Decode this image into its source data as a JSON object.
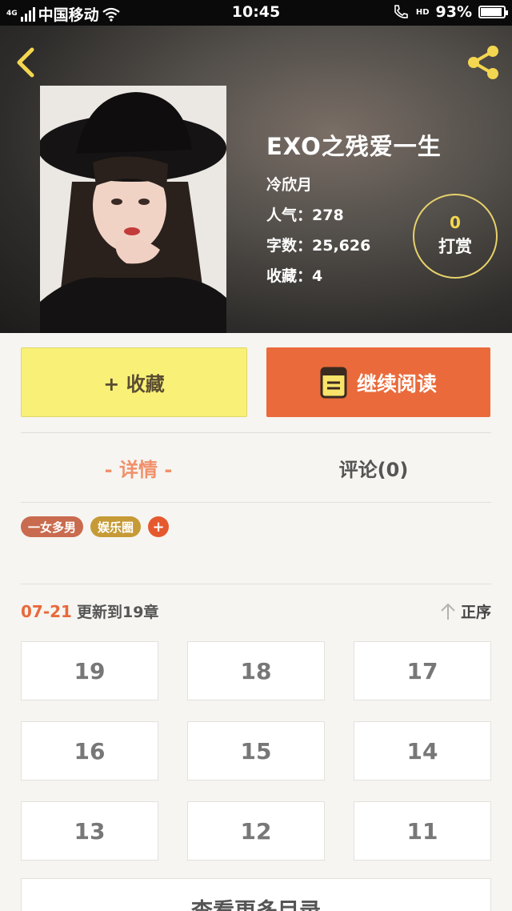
{
  "status_bar": {
    "network": "4G",
    "carrier": "中国移动",
    "time": "10:45",
    "hd": "HD",
    "battery": "93%",
    "battery_level": 0.93
  },
  "header": {
    "back_icon": "chevron-left-icon",
    "share_icon": "share-icon",
    "accent_color": "#f4d750"
  },
  "book": {
    "title": "EXO之残爱一生",
    "author": "冷欣月",
    "popularity": "人气：278",
    "word_count": "字数：25,626",
    "favorites": "收藏：4"
  },
  "tip": {
    "count": "0",
    "label": "打赏"
  },
  "actions": {
    "collect_label": "+ 收藏",
    "read_label": "继续阅读",
    "read_icon": "book-icon",
    "collect_color": "#f9f177",
    "read_color": "#ea6a3b"
  },
  "tabs": {
    "details": "- 详情 -",
    "comments": "评论(0)"
  },
  "tags": [
    {
      "label": "一女多男",
      "color": "#c96b4f"
    },
    {
      "label": "娱乐圈",
      "color": "#c69a36"
    }
  ],
  "tag_add": "+",
  "update": {
    "date": "07-21",
    "text": "更新到19章"
  },
  "sort": {
    "icon": "arrow-up-icon",
    "label": "正序"
  },
  "chapters": [
    "19",
    "18",
    "17",
    "16",
    "15",
    "14",
    "13",
    "12",
    "11"
  ],
  "more": {
    "label": "查看更多目录"
  }
}
